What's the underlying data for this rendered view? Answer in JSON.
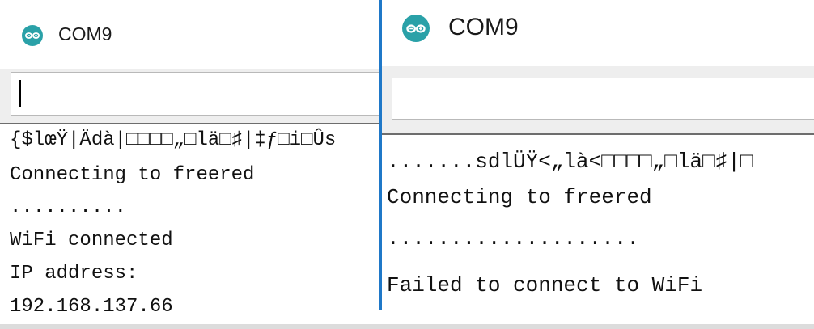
{
  "colors": {
    "arduino_teal": "#2aa1a8",
    "window_divider": "#1f78c8",
    "input_band": "#eeeeee",
    "separator": "#6d6d6d"
  },
  "left_window": {
    "title": "COM9",
    "logo_icon": "arduino-logo-icon",
    "input_value": "",
    "serial_lines": [
      "{$lœŸ|Ädà|□□□□„□lä□♯|‡ƒ□i□Ûs",
      "Connecting to freered",
      "..........",
      "WiFi connected",
      "IP address:",
      "192.168.137.66"
    ]
  },
  "right_window": {
    "title": "COM9",
    "logo_icon": "arduino-logo-icon",
    "input_value": "",
    "serial_lines": [
      ".......sdlÜŸ<„là<□□□□„□lä□♯|□",
      "Connecting to freered",
      "....................",
      "Failed to connect to WiFi"
    ]
  }
}
